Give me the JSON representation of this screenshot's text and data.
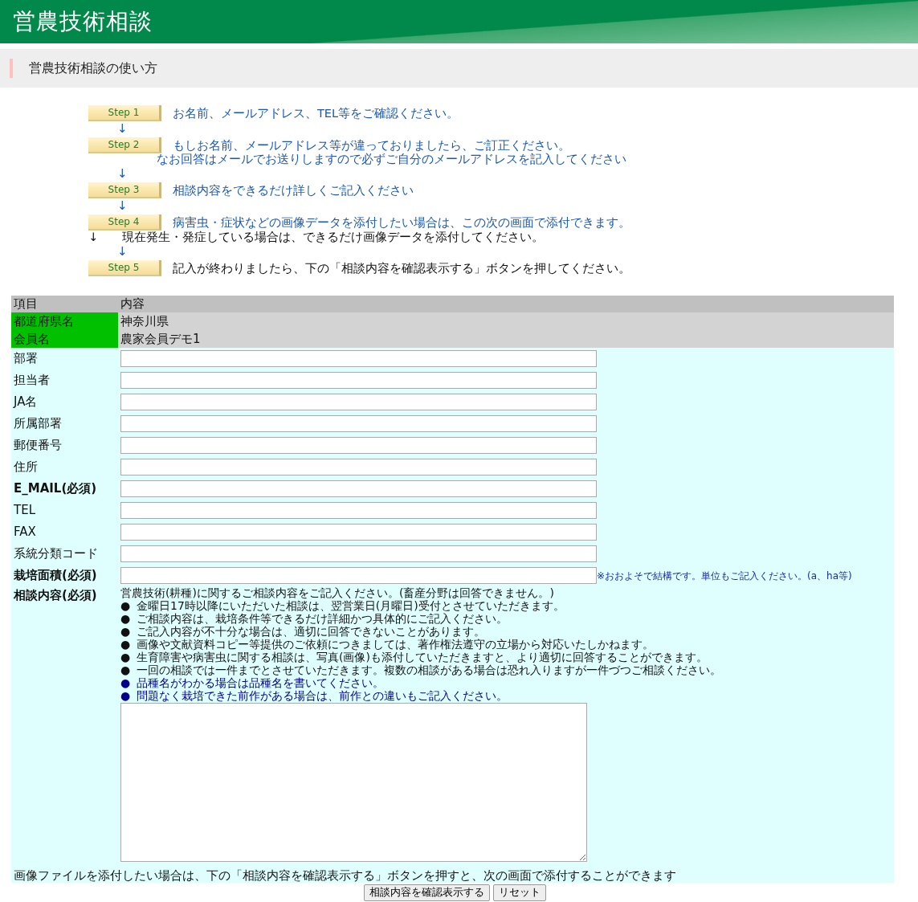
{
  "header": {
    "title": "営農技術相談"
  },
  "section": {
    "title": "営農技術相談の使い方"
  },
  "flow": [
    {
      "kind": "step",
      "label": "Step 1",
      "lines": [
        {
          "text": "お名前、メールアドレス、TEL等をご確認ください。",
          "emphasis": true
        }
      ]
    },
    {
      "kind": "arrow",
      "text": "↓"
    },
    {
      "kind": "step",
      "label": "Step 2",
      "lines": [
        {
          "text": "もしお名前、メールアドレス等が違っておりましたら、ご訂正ください。",
          "emphasis": true
        },
        {
          "text": "なお回答はメールでお送りしますので必ずご自分のメールアドレスを記入してください",
          "emphasis": true,
          "outdent": true
        }
      ]
    },
    {
      "kind": "arrow",
      "text": "↓"
    },
    {
      "kind": "step",
      "label": "Step 3",
      "lines": [
        {
          "text": "相談内容をできるだけ詳しくご記入ください",
          "emphasis": true
        }
      ]
    },
    {
      "kind": "arrow",
      "text": "↓"
    },
    {
      "kind": "step",
      "label": "Step 4",
      "lines": [
        {
          "text": "病害虫・症状などの画像データを添付したい場合は、この次の画面で添付できます。",
          "emphasis": true
        }
      ]
    },
    {
      "kind": "note",
      "arrow": "↓",
      "text": "現在発生・発症している場合は、できるだけ画像データを添付してください。"
    },
    {
      "kind": "arrow",
      "text": "↓"
    },
    {
      "kind": "step",
      "label": "Step 5",
      "lines": [
        {
          "text": "記入が終わりましたら、下の「相談内容を確認表示する」ボタンを押してください。",
          "emphasis": false
        }
      ]
    }
  ],
  "table": {
    "columns": [
      "項目",
      "内容"
    ],
    "rows": [
      {
        "kind": "fixed",
        "label": "都道府県名",
        "value": "神奈川県"
      },
      {
        "kind": "fixed",
        "label": "会員名",
        "value": "農家会員デモ1"
      },
      {
        "kind": "input",
        "label": "部署",
        "required": false
      },
      {
        "kind": "input",
        "label": "担当者",
        "required": false
      },
      {
        "kind": "input",
        "label": "JA名",
        "required": false
      },
      {
        "kind": "input",
        "label": "所属部署",
        "required": false
      },
      {
        "kind": "input",
        "label": "郵便番号",
        "required": false
      },
      {
        "kind": "input",
        "label": "住所",
        "required": false
      },
      {
        "kind": "input",
        "label": "E_MAIL(必須)",
        "required": true
      },
      {
        "kind": "input",
        "label": "TEL",
        "required": false
      },
      {
        "kind": "input",
        "label": "FAX",
        "required": false
      },
      {
        "kind": "input",
        "label": "系統分類コード",
        "required": false
      },
      {
        "kind": "input",
        "label": "栽培面積(必須)",
        "required": true,
        "note": "※おおよそで結構です。単位もご記入ください。(a、ha等)"
      },
      {
        "kind": "textarea",
        "label": "相談内容(必須)",
        "required": true,
        "intro": "営農技術(耕種)に関するご相談内容をご記入ください。(畜産分野は回答できません。)",
        "bullets": [
          {
            "bullet": "●",
            "text": "金曜日17時以降にいただいた相談は、翌営業日(月曜日)受付とさせていただきます。",
            "emphasis": false
          },
          {
            "bullet": "●",
            "text": "ご相談内容は、栽培条件等できるだけ詳細かつ具体的にご記入ください。",
            "emphasis": false
          },
          {
            "bullet": "●",
            "text": "ご記入内容が不十分な場合は、適切に回答できないことがあります。",
            "emphasis": false
          },
          {
            "bullet": "●",
            "text": "画像や文献資料コピー等提供のご依頼につきましては、著作権法遵守の立場から対応いたしかねます。",
            "emphasis": false
          },
          {
            "bullet": "●",
            "text": "生育障害や病害虫に関する相談は、写真(画像)も添付していただきますと、より適切に回答することができます。",
            "emphasis": false
          },
          {
            "bullet": "●",
            "text": "一回の相談では一件までとさせていただきます。複数の相談がある場合は恐れ入りますが一件づつご相談ください。",
            "emphasis": false
          },
          {
            "bullet": "●",
            "text": "品種名がわかる場合は品種名を書いてください。",
            "emphasis": true
          },
          {
            "bullet": "●",
            "text": "問題なく栽培できた前作がある場合は、前作との違いもご記入ください。",
            "emphasis": true
          }
        ]
      }
    ],
    "footer_note": "画像ファイルを添付したい場合は、下の「相談内容を確認表示する」ボタンを押すと、次の画面で添付することができます"
  },
  "buttons": [
    "相談内容を確認表示する",
    "リセット"
  ]
}
